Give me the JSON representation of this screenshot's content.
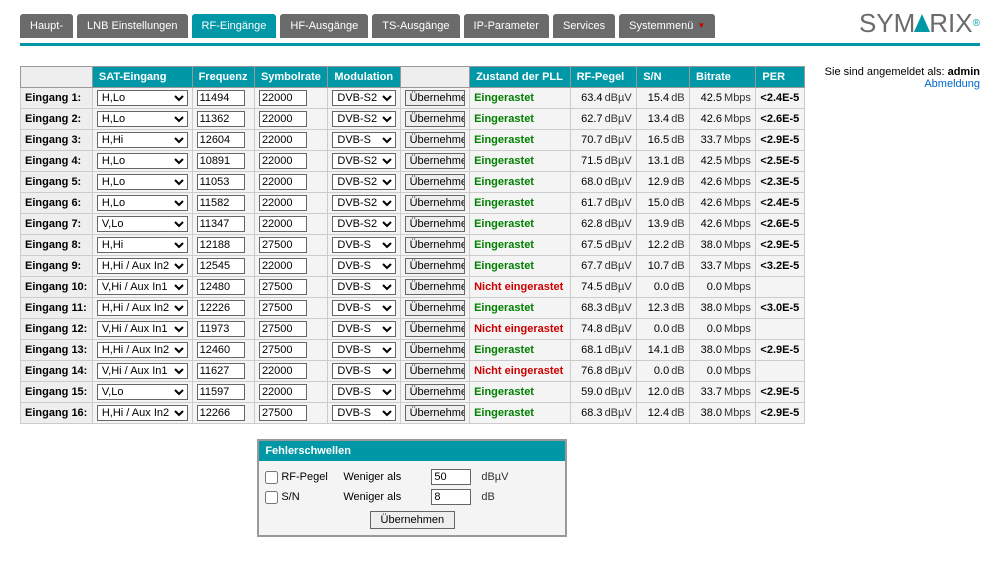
{
  "nav": {
    "tabs": [
      {
        "label": "Haupt-",
        "active": false
      },
      {
        "label": "LNB Einstellungen",
        "active": false
      },
      {
        "label": "RF-Eingänge",
        "active": true
      },
      {
        "label": "HF-Ausgänge",
        "active": false
      },
      {
        "label": "TS-Ausgänge",
        "active": false
      },
      {
        "label": "IP-Parameter",
        "active": false
      },
      {
        "label": "Services",
        "active": false
      },
      {
        "label": "Systemmenü",
        "active": false,
        "dropdown": true
      }
    ]
  },
  "logo": {
    "part1": "SYM",
    "part2": "RIX"
  },
  "sidebar": {
    "logged_in_prefix": "Sie sind angemeldet als: ",
    "user": "admin",
    "logout": "Abmeldung"
  },
  "table": {
    "headers": {
      "sat": "SAT-Eingang",
      "freq": "Frequenz",
      "sym": "Symbolrate",
      "mod": "Modulation",
      "apply": "",
      "pll": "Zustand der PLL",
      "rf": "RF-Pegel",
      "sn": "S/N",
      "bitrate": "Bitrate",
      "per": "PER"
    },
    "row_label_prefix": "Eingang ",
    "apply_button": "Übernehmen",
    "units": {
      "rf": "dBµV",
      "sn": "dB",
      "bitrate": "Mbps"
    },
    "pll_text": {
      "locked": "Eingerastet",
      "unlocked": "Nicht eingerastet"
    },
    "rows": [
      {
        "n": 1,
        "sat": "H,Lo",
        "freq": "11494",
        "sym": "22000",
        "mod": "DVB-S2",
        "locked": true,
        "rf": "63.4",
        "sn": "15.4",
        "bitrate": "42.5",
        "per": "<2.4E-5"
      },
      {
        "n": 2,
        "sat": "H,Lo",
        "freq": "11362",
        "sym": "22000",
        "mod": "DVB-S2",
        "locked": true,
        "rf": "62.7",
        "sn": "13.4",
        "bitrate": "42.6",
        "per": "<2.6E-5"
      },
      {
        "n": 3,
        "sat": "H,Hi",
        "freq": "12604",
        "sym": "22000",
        "mod": "DVB-S",
        "locked": true,
        "rf": "70.7",
        "sn": "16.5",
        "bitrate": "33.7",
        "per": "<2.9E-5"
      },
      {
        "n": 4,
        "sat": "H,Lo",
        "freq": "10891",
        "sym": "22000",
        "mod": "DVB-S2",
        "locked": true,
        "rf": "71.5",
        "sn": "13.1",
        "bitrate": "42.5",
        "per": "<2.5E-5"
      },
      {
        "n": 5,
        "sat": "H,Lo",
        "freq": "11053",
        "sym": "22000",
        "mod": "DVB-S2",
        "locked": true,
        "rf": "68.0",
        "sn": "12.9",
        "bitrate": "42.6",
        "per": "<2.3E-5"
      },
      {
        "n": 6,
        "sat": "H,Lo",
        "freq": "11582",
        "sym": "22000",
        "mod": "DVB-S2",
        "locked": true,
        "rf": "61.7",
        "sn": "15.0",
        "bitrate": "42.6",
        "per": "<2.4E-5"
      },
      {
        "n": 7,
        "sat": "V,Lo",
        "freq": "11347",
        "sym": "22000",
        "mod": "DVB-S2",
        "locked": true,
        "rf": "62.8",
        "sn": "13.9",
        "bitrate": "42.6",
        "per": "<2.6E-5"
      },
      {
        "n": 8,
        "sat": "H,Hi",
        "freq": "12188",
        "sym": "27500",
        "mod": "DVB-S",
        "locked": true,
        "rf": "67.5",
        "sn": "12.2",
        "bitrate": "38.0",
        "per": "<2.9E-5"
      },
      {
        "n": 9,
        "sat": "H,Hi / Aux In2",
        "freq": "12545",
        "sym": "22000",
        "mod": "DVB-S",
        "locked": true,
        "rf": "67.7",
        "sn": "10.7",
        "bitrate": "33.7",
        "per": "<3.2E-5"
      },
      {
        "n": 10,
        "sat": "V,Hi / Aux In1",
        "freq": "12480",
        "sym": "27500",
        "mod": "DVB-S",
        "locked": false,
        "rf": "74.5",
        "sn": "0.0",
        "bitrate": "0.0",
        "per": ""
      },
      {
        "n": 11,
        "sat": "H,Hi / Aux In2",
        "freq": "12226",
        "sym": "27500",
        "mod": "DVB-S",
        "locked": true,
        "rf": "68.3",
        "sn": "12.3",
        "bitrate": "38.0",
        "per": "<3.0E-5"
      },
      {
        "n": 12,
        "sat": "V,Hi / Aux In1",
        "freq": "11973",
        "sym": "27500",
        "mod": "DVB-S",
        "locked": false,
        "rf": "74.8",
        "sn": "0.0",
        "bitrate": "0.0",
        "per": ""
      },
      {
        "n": 13,
        "sat": "H,Hi / Aux In2",
        "freq": "12460",
        "sym": "27500",
        "mod": "DVB-S",
        "locked": true,
        "rf": "68.1",
        "sn": "14.1",
        "bitrate": "38.0",
        "per": "<2.9E-5"
      },
      {
        "n": 14,
        "sat": "V,Hi / Aux In1",
        "freq": "11627",
        "sym": "22000",
        "mod": "DVB-S",
        "locked": false,
        "rf": "76.8",
        "sn": "0.0",
        "bitrate": "0.0",
        "per": ""
      },
      {
        "n": 15,
        "sat": "V,Lo",
        "freq": "11597",
        "sym": "22000",
        "mod": "DVB-S",
        "locked": true,
        "rf": "59.0",
        "sn": "12.0",
        "bitrate": "33.7",
        "per": "<2.9E-5"
      },
      {
        "n": 16,
        "sat": "H,Hi / Aux In2",
        "freq": "12266",
        "sym": "27500",
        "mod": "DVB-S",
        "locked": true,
        "rf": "68.3",
        "sn": "12.4",
        "bitrate": "38.0",
        "per": "<2.9E-5"
      }
    ]
  },
  "thresholds": {
    "title": "Fehlerschwellen",
    "less_than": "Weniger als",
    "rf_label": "RF-Pegel",
    "rf_value": "50",
    "rf_unit": "dBµV",
    "rf_checked": false,
    "sn_label": "S/N",
    "sn_value": "8",
    "sn_unit": "dB",
    "sn_checked": false,
    "apply": "Übernehmen"
  }
}
